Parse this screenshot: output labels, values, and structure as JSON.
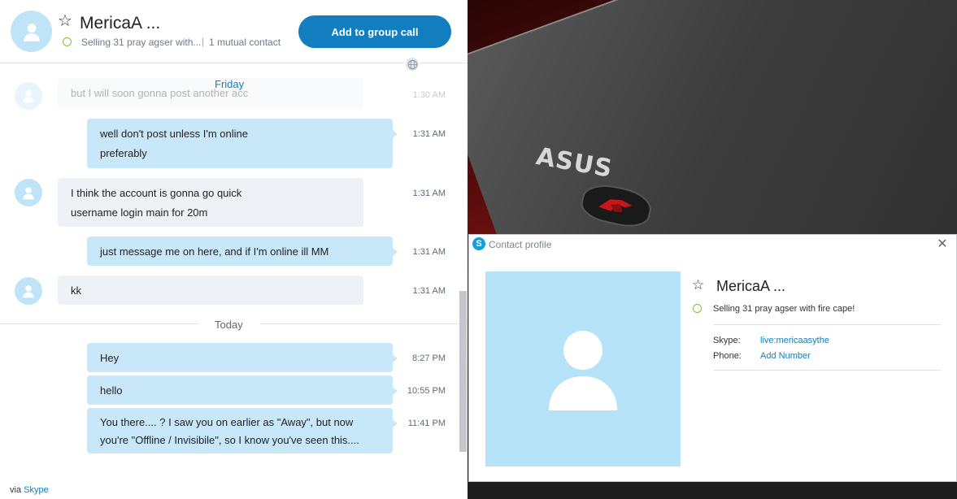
{
  "chat": {
    "contact_name": "MericaA ...",
    "mood": "Selling 31 pray agser with...",
    "separator": "|",
    "mutual_contacts": "1 mutual contact",
    "group_call_label": "Add to group call",
    "day_friday": "Friday",
    "day_today": "Today",
    "messages": [
      {
        "dir": "in",
        "lines": [
          "but I will soon gonna post another acc"
        ],
        "time": "1:30 AM"
      },
      {
        "dir": "out",
        "lines": [
          "well don't post unless I'm online",
          "preferably"
        ],
        "time": "1:31 AM"
      },
      {
        "dir": "in",
        "lines": [
          "I think the account is gonna go quick",
          "username login main for 20m"
        ],
        "time": "1:31 AM"
      },
      {
        "dir": "out",
        "lines": [
          "just message me on here, and if I'm online ill MM"
        ],
        "time": "1:31 AM"
      },
      {
        "dir": "in",
        "lines": [
          "kk"
        ],
        "time": "1:31 AM"
      },
      {
        "dir": "out",
        "lines": [
          "Hey"
        ],
        "time": "8:27 PM"
      },
      {
        "dir": "out",
        "lines": [
          "hello"
        ],
        "time": "10:55 PM"
      },
      {
        "dir": "out",
        "lines": [
          "You there.... ? I saw you on earlier as \"Away\", but now",
          "you're \"Offline / Invisibile\", so I know you've seen this...."
        ],
        "time": "11:41 PM"
      }
    ],
    "via_prefix": "via",
    "via_link": "Skype"
  },
  "wallpaper": {
    "logo_text": "ASUS"
  },
  "profile": {
    "window_title": "Contact profile",
    "close_glyph": "✕",
    "name": "MericaA ...",
    "mood": "Selling 31 pray agser with fire cape!",
    "skype_label": "Skype:",
    "skype_value": "live:mericaasythe",
    "phone_label": "Phone:",
    "phone_value": "Add Number"
  },
  "colors": {
    "accent": "#127dbf",
    "outgoing_bubble": "#c8e8fa",
    "incoming_bubble": "#eef1f5",
    "avatar_bg": "#bfe4f8",
    "online_ring": "#7cc242"
  },
  "icons": {
    "star": "star-icon",
    "avatar": "person-icon",
    "globe": "globe-icon",
    "close": "close-icon",
    "skype": "skype-icon"
  }
}
